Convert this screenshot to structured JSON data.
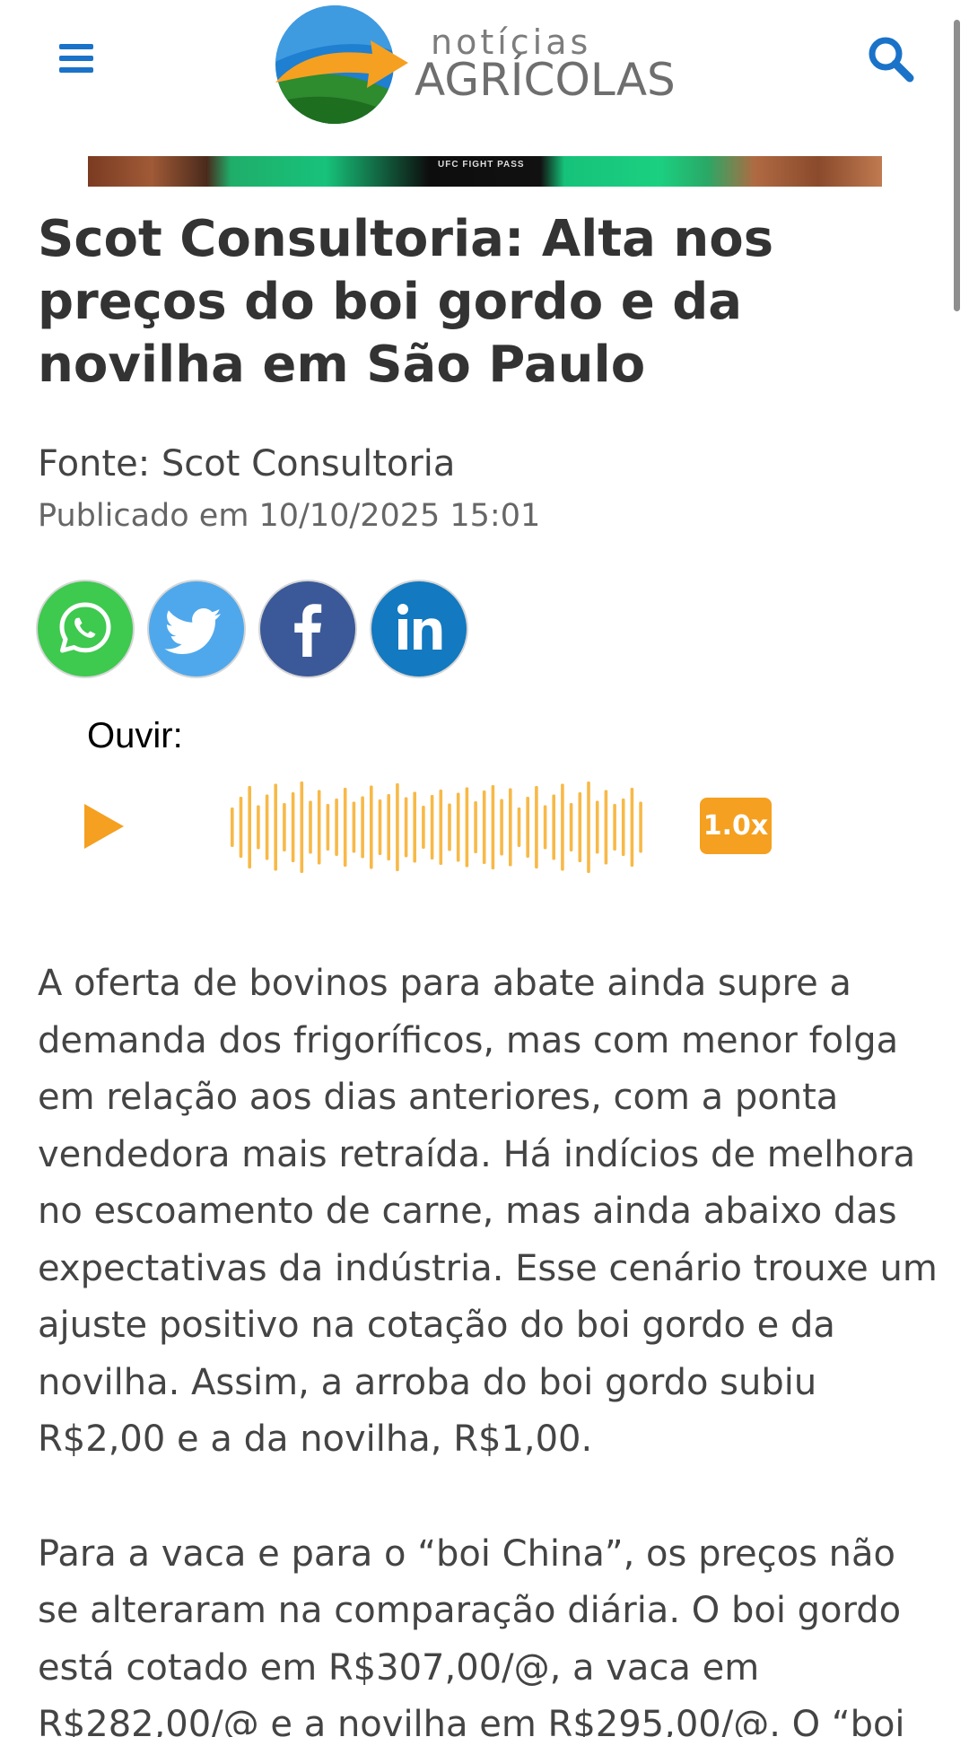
{
  "header": {
    "menu_icon": "hamburger-menu-icon",
    "search_icon": "search-icon",
    "logo": {
      "line1": "notícias",
      "line2": "AGRÍCOLAS"
    }
  },
  "ad": {
    "label": "UFC FIGHT PASS"
  },
  "article": {
    "title": "Scot Consultoria: Alta nos preços do boi gordo e da novilha em São Paulo",
    "source": "Fonte: Scot Consultoria",
    "published": "Publicado em 10/10/2025 15:01"
  },
  "share": {
    "buttons": [
      {
        "icon": "whatsapp-icon",
        "color": "#3ec94f"
      },
      {
        "icon": "twitter-icon",
        "color": "#4fa8ec"
      },
      {
        "icon": "facebook-icon",
        "color": "#3b5998"
      },
      {
        "icon": "linkedin-icon",
        "color": "#1379c0"
      }
    ]
  },
  "audio": {
    "label": "Ouvir:",
    "play_icon": "play-icon",
    "speed": "1.0x",
    "accent": "#f5a020",
    "wave_color": "#f7b948"
  },
  "body": {
    "paragraphs": [
      "A oferta de bovinos para abate ainda supre a demanda dos frigoríficos, mas com menor folga em relação aos dias anteriores, com a ponta vendedora mais retraída. Há indícios de melhora no escoamento de carne, mas ainda abaixo das expectativas da indústria. Esse cenário trouxe um ajuste positivo na cotação do boi gordo e da novilha. Assim, a arroba do boi gordo subiu R$2,00 e a da novilha, R$1,00.",
      "Para a vaca e para o “boi China”, os preços não se alteraram na comparação diária. O boi gordo está cotado em R$307,00/@, a vaca em R$282,00/@ e a novilha em R$295,00/@. O “boi"
    ]
  },
  "colors": {
    "accent_blue": "#1a73c8",
    "title_text": "#333333",
    "body_text": "#444444"
  }
}
